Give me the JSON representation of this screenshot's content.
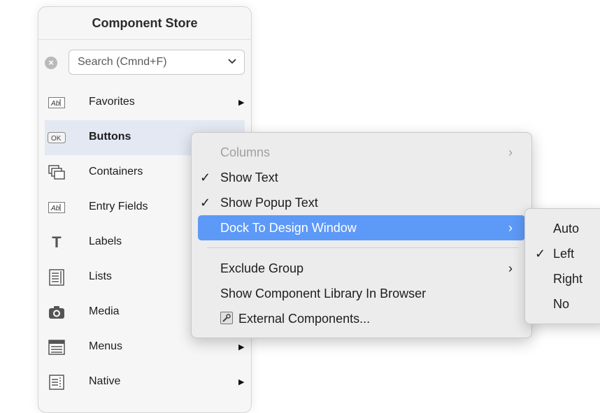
{
  "panel": {
    "title": "Component Store",
    "search": {
      "placeholder": "Search (Cmnd+F)",
      "value": ""
    },
    "items": [
      {
        "label": "Favorites",
        "icon": "text-field-icon",
        "has_submenu": true,
        "selected": false
      },
      {
        "label": "Buttons",
        "icon": "ok-button-icon",
        "icon_text": "OK",
        "has_submenu": false,
        "selected": true
      },
      {
        "label": "Containers",
        "icon": "stacked-windows-icon",
        "has_submenu": false,
        "selected": false
      },
      {
        "label": "Entry Fields",
        "icon": "text-field-icon",
        "has_submenu": false,
        "selected": false
      },
      {
        "label": "Labels",
        "icon": "letter-t-icon",
        "icon_text": "T",
        "has_submenu": false,
        "selected": false
      },
      {
        "label": "Lists",
        "icon": "list-icon",
        "has_submenu": false,
        "selected": false
      },
      {
        "label": "Media",
        "icon": "camera-icon",
        "has_submenu": false,
        "selected": false
      },
      {
        "label": "Menus",
        "icon": "menu-icon",
        "has_submenu": true,
        "selected": false
      },
      {
        "label": "Native",
        "icon": "native-list-icon",
        "has_submenu": true,
        "selected": false
      }
    ]
  },
  "context_menu": {
    "items": [
      {
        "label": "Columns",
        "checked": false,
        "disabled": true,
        "submenu": true
      },
      {
        "label": "Show Text",
        "checked": true,
        "disabled": false,
        "submenu": false
      },
      {
        "label": "Show Popup Text",
        "checked": true,
        "disabled": false,
        "submenu": false
      },
      {
        "label": "Dock To Design Window",
        "checked": false,
        "disabled": false,
        "submenu": true,
        "highlighted": true
      },
      {
        "label": "Exclude Group",
        "checked": false,
        "disabled": false,
        "submenu": true
      },
      {
        "label": "Show Component Library In Browser",
        "checked": false,
        "disabled": false,
        "submenu": false
      },
      {
        "label": "External Components...",
        "checked": false,
        "disabled": false,
        "submenu": false,
        "icon": "wrench-icon"
      }
    ],
    "check_glyph": "✓",
    "arrow_glyph": "›",
    "highlight_color": "#5d99f7"
  },
  "dock_submenu": {
    "items": [
      {
        "label": "Auto",
        "checked": false
      },
      {
        "label": "Left",
        "checked": true
      },
      {
        "label": "Right",
        "checked": false
      },
      {
        "label": "No",
        "checked": false
      }
    ]
  }
}
